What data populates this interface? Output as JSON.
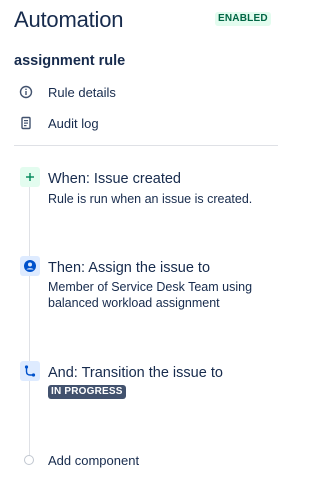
{
  "header": {
    "title": "Automation",
    "status_badge": "ENABLED"
  },
  "rule": {
    "name": "assignment rule"
  },
  "nav": {
    "items": [
      {
        "label": "Rule details",
        "icon": "info-icon"
      },
      {
        "label": "Audit log",
        "icon": "document-icon"
      }
    ]
  },
  "steps": [
    {
      "type": "trigger",
      "icon": "plus-icon",
      "heading": "When: Issue created",
      "description": "Rule is run when an issue is created."
    },
    {
      "type": "action",
      "icon": "person-icon",
      "heading": "Then: Assign the issue to",
      "description": "Member of Service Desk Team using balanced workload assignment"
    },
    {
      "type": "action",
      "icon": "transition-icon",
      "heading": "And: Transition the issue to",
      "status": "IN PROGRESS"
    }
  ],
  "add_component_label": "Add component",
  "colors": {
    "text": "#172b4d",
    "enabled_bg": "#e3fcef",
    "enabled_text": "#006644",
    "action_icon_bg": "#deebff",
    "action_icon_fg": "#0052cc",
    "lozenge_bg": "#42526e",
    "divider": "#dfe1e6"
  }
}
